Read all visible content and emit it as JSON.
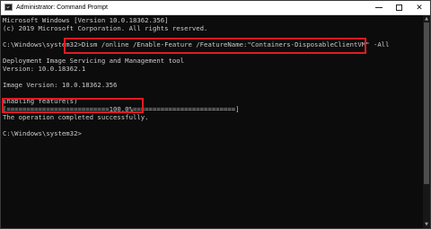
{
  "window": {
    "title": "Administrator: Command Prompt",
    "minimize_glyph": "",
    "maximize_glyph": "",
    "close_glyph": "✕"
  },
  "console": {
    "lines": [
      "Microsoft Windows [Version 10.0.18362.356]",
      "(c) 2019 Microsoft Corporation. All rights reserved.",
      "",
      "C:\\Windows\\system32>Dism /online /Enable-Feature /FeatureName:\"Containers-DisposableClientVM\" -All",
      "",
      "Deployment Image Servicing and Management tool",
      "Version: 10.0.18362.1",
      "",
      "Image Version: 10.0.18362.356",
      "",
      "Enabling feature(s)",
      "[==========================100.0%==========================]",
      "The operation completed successfully.",
      "",
      "C:\\Windows\\system32>"
    ]
  },
  "annotations": {
    "highlight_color": "#e11b22"
  },
  "scrollbar": {
    "up_glyph": "▲",
    "down_glyph": "▼"
  }
}
